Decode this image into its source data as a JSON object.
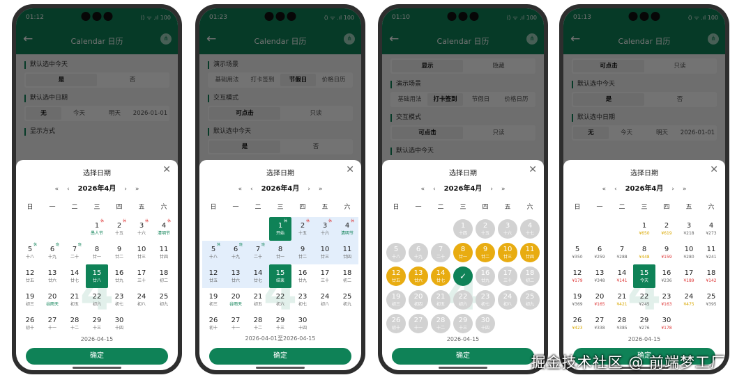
{
  "nav_title": "Calendar 日历",
  "status_icons": "⟨⟩ ᯤ .ıl 100",
  "weekdays": [
    "日",
    "一",
    "二",
    "三",
    "四",
    "五",
    "六"
  ],
  "month_label": "2026年4月",
  "prev_year": "«",
  "prev_month": "‹",
  "next_month": "›",
  "next_year": "»",
  "sheet_title": "选择日期",
  "confirm_label": "确定",
  "watermark_digit": "4",
  "site_watermark": "掘金技术社区 @ 前端梦工厂",
  "phones": [
    {
      "time": "01:12",
      "sections": [
        {
          "title": "默认选中今天",
          "options": [
            "是",
            "否"
          ],
          "active": 0
        },
        {
          "title": "默认选中日期",
          "options": [
            "无",
            "今天",
            "明天",
            "2026-01-01"
          ],
          "active": 0
        },
        {
          "title": "显示方式",
          "options": []
        }
      ],
      "footer": "2026-04-15",
      "cells": [
        {},
        {},
        {},
        {
          "d": "1",
          "s": "愚人节",
          "sc": "g",
          "t": "休"
        },
        {
          "d": "2",
          "s": "十五",
          "t": "休"
        },
        {
          "d": "3",
          "s": "十六",
          "t": "休"
        },
        {
          "d": "4",
          "s": "清明节",
          "sc": "g",
          "t": "休"
        },
        {
          "d": "5",
          "s": "十八",
          "t": "休",
          "tc": "g"
        },
        {
          "d": "6",
          "s": "十九",
          "t": "班",
          "tc": "g"
        },
        {
          "d": "7",
          "s": "二十",
          "t": "班",
          "tc": "g"
        },
        {
          "d": "8",
          "s": "廿一"
        },
        {
          "d": "9",
          "s": "廿二"
        },
        {
          "d": "10",
          "s": "廿三"
        },
        {
          "d": "11",
          "s": "廿四"
        },
        {
          "d": "12",
          "s": "廿五"
        },
        {
          "d": "13",
          "s": "廿六"
        },
        {
          "d": "14",
          "s": "廿七"
        },
        {
          "d": "15",
          "s": "廿八",
          "st": "sel"
        },
        {
          "d": "16",
          "s": "廿九"
        },
        {
          "d": "17",
          "s": "三十"
        },
        {
          "d": "18",
          "s": "初二"
        },
        {
          "d": "19",
          "s": "初三"
        },
        {
          "d": "20",
          "s": "谷雨天",
          "sc": "g"
        },
        {
          "d": "21",
          "s": "初五"
        },
        {
          "d": "22",
          "s": "初六"
        },
        {
          "d": "23",
          "s": "初七"
        },
        {
          "d": "24",
          "s": "初八"
        },
        {
          "d": "25",
          "s": "初九"
        },
        {
          "d": "26",
          "s": "初十"
        },
        {
          "d": "27",
          "s": "十一"
        },
        {
          "d": "28",
          "s": "十二"
        },
        {
          "d": "29",
          "s": "十三"
        },
        {
          "d": "30",
          "s": "十四"
        }
      ]
    },
    {
      "time": "01:23",
      "sections": [
        {
          "title": "演示场景",
          "options": [
            "基础用法",
            "打卡签到",
            "节假日",
            "价格日历"
          ],
          "active": 2
        },
        {
          "title": "交互模式",
          "options": [
            "可点击",
            "只读"
          ],
          "active": 0
        },
        {
          "title": "默认选中今天",
          "options": [
            "是",
            "否"
          ],
          "active": 0
        }
      ],
      "footer": "2026-04-01至2026-04-15",
      "cells": [
        {},
        {},
        {},
        {
          "d": "1",
          "s": "开始",
          "t": "休",
          "st": "sel"
        },
        {
          "d": "2",
          "s": "十五",
          "t": "休",
          "st": "range"
        },
        {
          "d": "3",
          "s": "十六",
          "t": "休",
          "st": "range"
        },
        {
          "d": "4",
          "s": "清明节",
          "sc": "g",
          "t": "休",
          "st": "range"
        },
        {
          "d": "5",
          "s": "十八",
          "t": "休",
          "tc": "g",
          "st": "range"
        },
        {
          "d": "6",
          "s": "十九",
          "t": "班",
          "tc": "g",
          "st": "range"
        },
        {
          "d": "7",
          "s": "二十",
          "t": "班",
          "tc": "g",
          "st": "range"
        },
        {
          "d": "8",
          "s": "廿一",
          "st": "range"
        },
        {
          "d": "9",
          "s": "廿二",
          "st": "range"
        },
        {
          "d": "10",
          "s": "廿三",
          "st": "range"
        },
        {
          "d": "11",
          "s": "廿四",
          "st": "range"
        },
        {
          "d": "12",
          "s": "廿五",
          "st": "range"
        },
        {
          "d": "13",
          "s": "廿六",
          "st": "range"
        },
        {
          "d": "14",
          "s": "廿七",
          "st": "range"
        },
        {
          "d": "15",
          "s": "结束",
          "st": "sel"
        },
        {
          "d": "16",
          "s": "廿九"
        },
        {
          "d": "17",
          "s": "三十"
        },
        {
          "d": "18",
          "s": "初二"
        },
        {
          "d": "19",
          "s": "初三"
        },
        {
          "d": "20",
          "s": "谷雨天",
          "sc": "g"
        },
        {
          "d": "21",
          "s": "初五"
        },
        {
          "d": "22",
          "s": "初六"
        },
        {
          "d": "23",
          "s": "初七"
        },
        {
          "d": "24",
          "s": "初八"
        },
        {
          "d": "25",
          "s": "初九"
        },
        {
          "d": "26",
          "s": "初十"
        },
        {
          "d": "27",
          "s": "十一"
        },
        {
          "d": "28",
          "s": "十二"
        },
        {
          "d": "29",
          "s": "十三"
        },
        {
          "d": "30",
          "s": "十四"
        }
      ]
    },
    {
      "time": "01:10",
      "sections": [
        {
          "title": "",
          "options": [
            "显示",
            "隐藏"
          ],
          "active": 0
        },
        {
          "title": "演示场景",
          "options": [
            "基础用法",
            "打卡签到",
            "节假日",
            "价格日历"
          ],
          "active": 1
        },
        {
          "title": "交互模式",
          "options": [
            "可点击",
            "只读"
          ],
          "active": 0
        },
        {
          "title": "默认选中今天",
          "options": []
        }
      ],
      "footer": "2026-04-15",
      "cells": [
        {},
        {},
        {},
        {
          "d": "1",
          "s": "十四",
          "st": "circ"
        },
        {
          "d": "2",
          "s": "十五",
          "st": "circ"
        },
        {
          "d": "3",
          "s": "十六",
          "st": "circ"
        },
        {
          "d": "4",
          "s": "十七",
          "st": "circ"
        },
        {
          "d": "5",
          "s": "十八",
          "st": "circ"
        },
        {
          "d": "6",
          "s": "十九",
          "st": "circ"
        },
        {
          "d": "7",
          "s": "二十",
          "st": "circ"
        },
        {
          "d": "8",
          "s": "廿一",
          "st": "circ yel"
        },
        {
          "d": "9",
          "s": "廿二",
          "st": "circ yel"
        },
        {
          "d": "10",
          "s": "廿三",
          "st": "circ yel"
        },
        {
          "d": "11",
          "s": "廿四",
          "st": "circ yel"
        },
        {
          "d": "12",
          "s": "廿五",
          "st": "circ yel"
        },
        {
          "d": "13",
          "s": "廿六",
          "st": "circ yel"
        },
        {
          "d": "14",
          "s": "廿七",
          "st": "circ yel"
        },
        {
          "d": "✓",
          "s": "",
          "st": "circ gr"
        },
        {
          "d": "16",
          "s": "廿九",
          "st": "circ"
        },
        {
          "d": "17",
          "s": "三十",
          "st": "circ"
        },
        {
          "d": "18",
          "s": "初二",
          "st": "circ"
        },
        {
          "d": "19",
          "s": "初三",
          "st": "circ"
        },
        {
          "d": "20",
          "s": "初四",
          "st": "circ"
        },
        {
          "d": "21",
          "s": "初五",
          "st": "circ"
        },
        {
          "d": "22",
          "s": "初六",
          "st": "circ"
        },
        {
          "d": "23",
          "s": "初七",
          "st": "circ"
        },
        {
          "d": "24",
          "s": "初八",
          "st": "circ"
        },
        {
          "d": "25",
          "s": "初九",
          "st": "circ"
        },
        {
          "d": "26",
          "s": "初十",
          "st": "circ"
        },
        {
          "d": "27",
          "s": "十一",
          "st": "circ"
        },
        {
          "d": "28",
          "s": "十二",
          "st": "circ"
        },
        {
          "d": "29",
          "s": "十三",
          "st": "circ"
        },
        {
          "d": "30",
          "s": "十四",
          "st": "circ"
        }
      ]
    },
    {
      "time": "01:13",
      "sections": [
        {
          "title": "",
          "options": [
            "可点击",
            "只读"
          ],
          "active": 0
        },
        {
          "title": "默认选中今天",
          "options": [
            "是",
            "否"
          ],
          "active": 0
        },
        {
          "title": "默认选中日期",
          "options": [
            "无",
            "今天",
            "明天",
            "2026-01-01"
          ],
          "active": 0
        }
      ],
      "footer": "2026-04-15",
      "cells": [
        {},
        {},
        {},
        {
          "d": "1",
          "s": "¥650",
          "sc": "y"
        },
        {
          "d": "2",
          "s": "¥619",
          "sc": "y"
        },
        {
          "d": "3",
          "s": "¥218"
        },
        {
          "d": "4",
          "s": "¥273"
        },
        {
          "d": "5",
          "s": "¥350"
        },
        {
          "d": "6",
          "s": "¥259"
        },
        {
          "d": "7",
          "s": "¥288"
        },
        {
          "d": "8",
          "s": "¥448",
          "sc": "y"
        },
        {
          "d": "9",
          "s": "¥159",
          "sc": "r"
        },
        {
          "d": "10",
          "s": "¥280"
        },
        {
          "d": "11",
          "s": "¥241"
        },
        {
          "d": "12",
          "s": "¥179",
          "sc": "r"
        },
        {
          "d": "13",
          "s": "¥348"
        },
        {
          "d": "14",
          "s": "¥141",
          "sc": "r"
        },
        {
          "d": "15",
          "s": "今天",
          "st": "sel"
        },
        {
          "d": "16",
          "s": "¥236"
        },
        {
          "d": "17",
          "s": "¥189",
          "sc": "r"
        },
        {
          "d": "18",
          "s": "¥142",
          "sc": "r"
        },
        {
          "d": "19",
          "s": "¥369"
        },
        {
          "d": "20",
          "s": "¥165",
          "sc": "r"
        },
        {
          "d": "21",
          "s": "¥421",
          "sc": "y"
        },
        {
          "d": "22",
          "s": "¥245"
        },
        {
          "d": "23",
          "s": "¥163",
          "sc": "r"
        },
        {
          "d": "24",
          "s": "¥475",
          "sc": "y"
        },
        {
          "d": "25",
          "s": "¥395"
        },
        {
          "d": "26",
          "s": "¥423",
          "sc": "y"
        },
        {
          "d": "27",
          "s": "¥338"
        },
        {
          "d": "28",
          "s": "¥385"
        },
        {
          "d": "29",
          "s": "¥276"
        },
        {
          "d": "30",
          "s": "¥178",
          "sc": "r"
        }
      ]
    }
  ]
}
